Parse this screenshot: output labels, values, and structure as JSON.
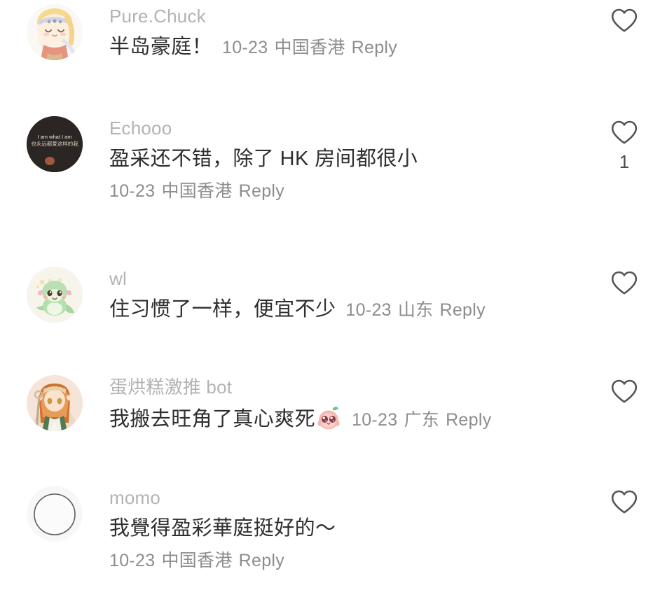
{
  "screen": {
    "app": "social-comment-list",
    "background": "#ffffff",
    "username_color": "#b3b3b3",
    "text_color": "#2f2f2f",
    "meta_color": "#8d8d8d"
  },
  "comments": [
    {
      "username": "Pure.Chuck",
      "text": "半岛豪庭！",
      "date": "10-23",
      "location": "中国香港",
      "reply_label": "Reply",
      "like_icon": "heart-icon",
      "like_count": "",
      "meta_inline": true,
      "avatar": "anime-blonde-headband-avatar"
    },
    {
      "username": "Echooo",
      "text": "盈采还不错，除了 HK 房间都很小",
      "date": "10-23",
      "location": "中国香港",
      "reply_label": "Reply",
      "like_icon": "heart-icon",
      "like_count": "1",
      "meta_inline": false,
      "avatar": "dark-photo-i-am-what-i-am-avatar",
      "avatar_text_en": "I am what I am",
      "avatar_text_zh": "也永远都爱这样的我"
    },
    {
      "username": "wl",
      "text": "住习惯了一样，便宜不少",
      "date": "10-23",
      "location": "山东",
      "reply_label": "Reply",
      "like_icon": "heart-icon",
      "like_count": "",
      "meta_inline": true,
      "avatar": "green-baby-dragon-avatar"
    },
    {
      "username": "蛋烘糕激推 bot",
      "text": "我搬去旺角了真心爽死",
      "emoji": "pink-peach-sparkle-eyes-sticker",
      "date": "10-23",
      "location": "广东",
      "reply_label": "Reply",
      "like_icon": "heart-icon",
      "like_count": "",
      "meta_inline": true,
      "avatar": "orange-hair-elf-girl-avatar"
    },
    {
      "username": "momo",
      "text": "我覺得盈彩華庭挺好的〜",
      "date": "10-23",
      "location": "中国香港",
      "reply_label": "Reply",
      "like_icon": "heart-icon",
      "like_count": "",
      "meta_inline": false,
      "avatar": "empty-circle-outline-avatar"
    }
  ]
}
